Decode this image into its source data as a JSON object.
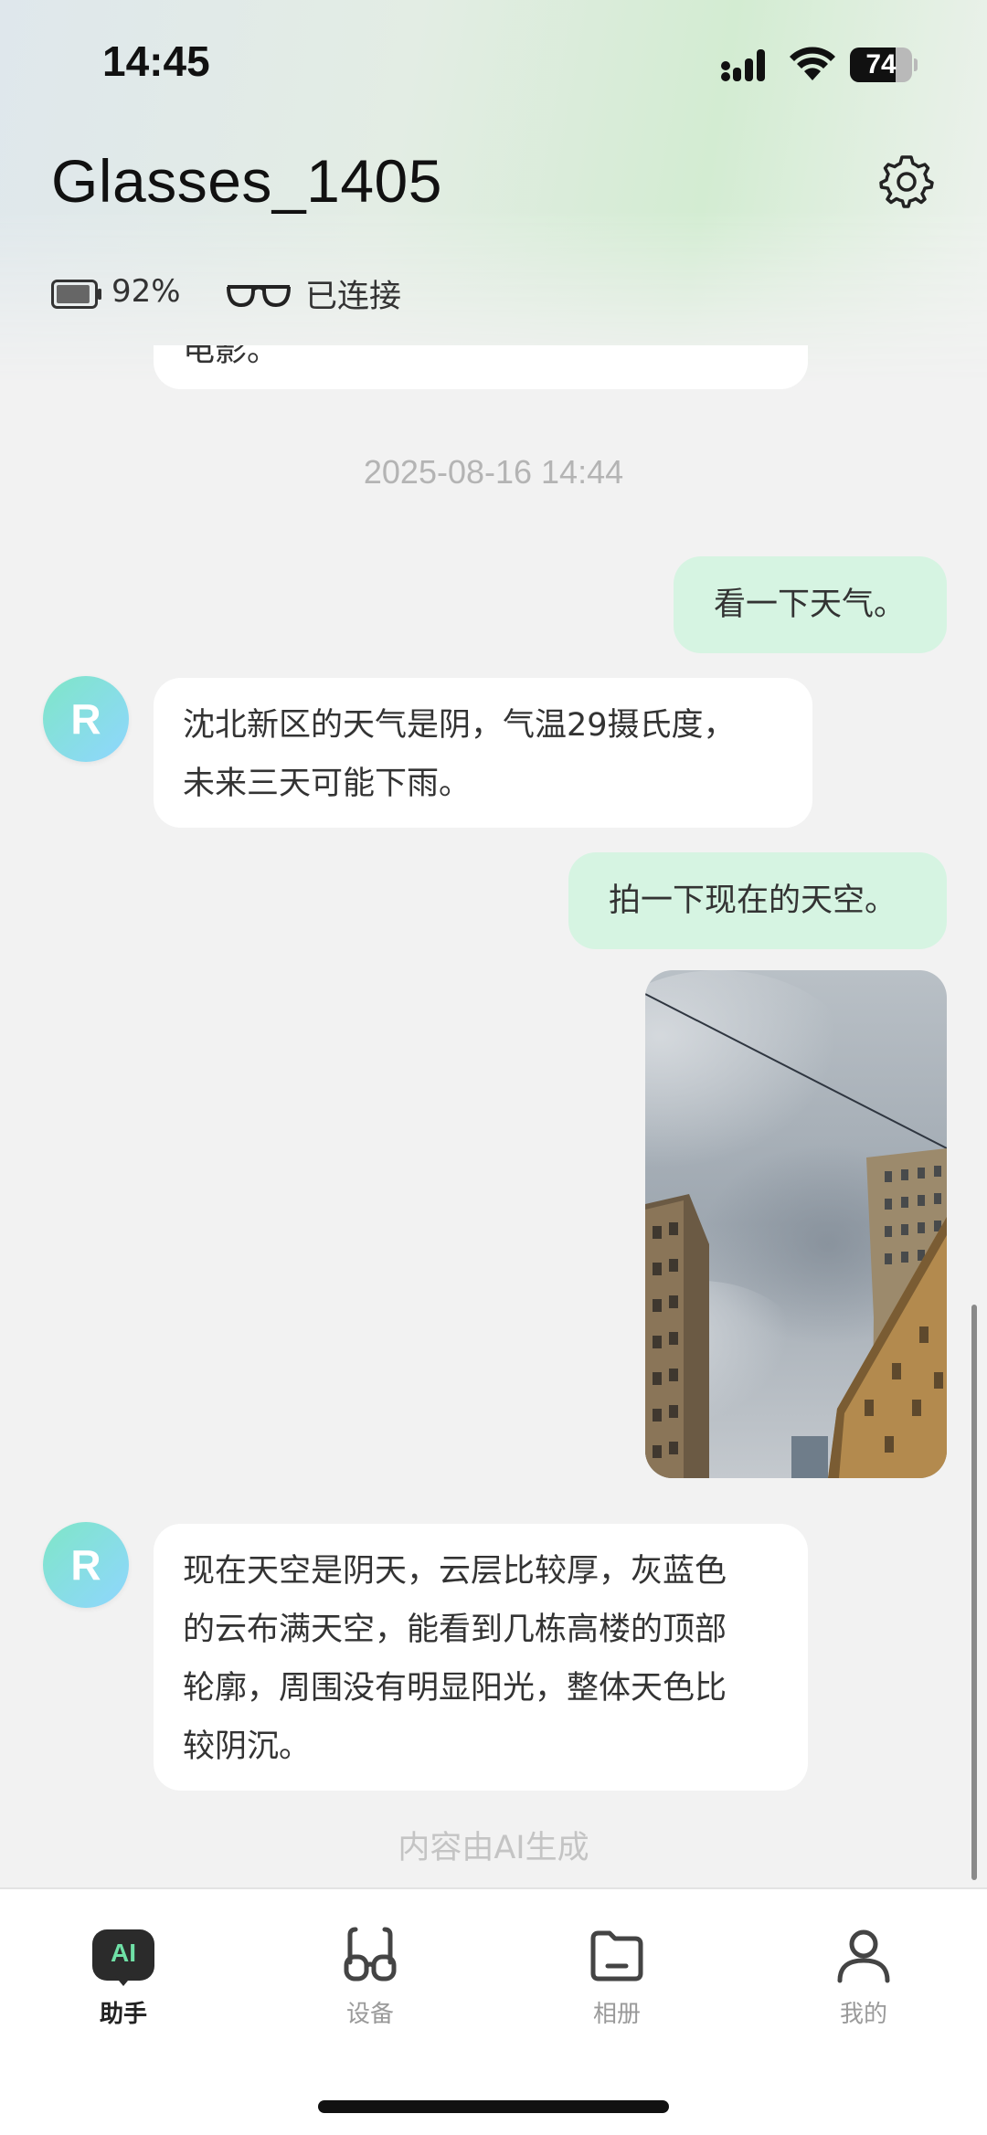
{
  "status_bar": {
    "time": "14:45",
    "battery_percent": "74",
    "battery_level": 0.74
  },
  "header": {
    "title": "Glasses_1405",
    "settings_icon": "gear-icon"
  },
  "device": {
    "battery_text": "92%",
    "battery_level": 0.92,
    "connection_text": "已连接"
  },
  "chat": {
    "partial_message": "电影。",
    "timestamp": "2025-08-16 14:44",
    "user_message_1": "看一下天气。",
    "ai_avatar_letter": "R",
    "ai_message_1_line1": "沈北新区的天气是阴，气温29摄氏度，",
    "ai_message_1_line2": "未来三天可能下雨。",
    "user_message_2": "拍一下现在的天空。",
    "ai_message_2_lines": [
      "现在天空是阴天，云层比较厚，灰蓝色",
      "的云布满天空，能看到几栋高楼的顶部",
      "轮廓，周围没有明显阳光，整体天色比",
      "较阴沉。"
    ],
    "ai_note": "内容由AI生成"
  },
  "tabbar": {
    "tabs": [
      {
        "label": "助手",
        "icon": "ai-assistant-icon",
        "badge": "AI",
        "active": true
      },
      {
        "label": "设备",
        "icon": "glasses-device-icon",
        "active": false
      },
      {
        "label": "相册",
        "icon": "folder-album-icon",
        "active": false
      },
      {
        "label": "我的",
        "icon": "person-icon",
        "active": false
      }
    ]
  },
  "colors": {
    "user_bubble": "#d6f4e2",
    "ai_bubble": "#ffffff",
    "background": "#f2f2f2",
    "ai_badge_text": "#6fe0a6"
  }
}
